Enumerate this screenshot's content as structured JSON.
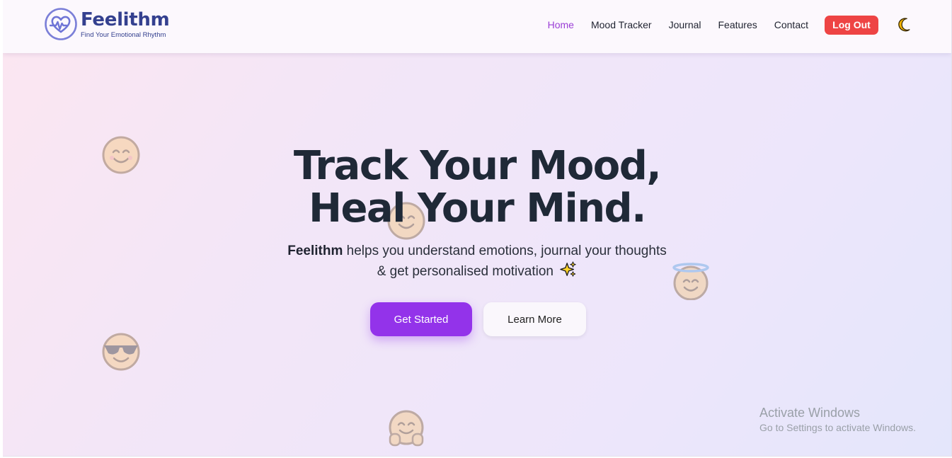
{
  "brand": {
    "name": "Feelithm",
    "tagline": "Find Your Emotional Rhythm",
    "logo_icon": "heart-pulse-icon",
    "color": "#34408f"
  },
  "nav": {
    "links": [
      "Home",
      "Mood Tracker",
      "Journal",
      "Features",
      "Contact"
    ],
    "active": "Home",
    "logout_label": "Log Out",
    "theme_icon": "moon-icon"
  },
  "hero": {
    "title_line1": "Track Your Mood,",
    "title_line2": "Heal Your Mind.",
    "subtitle_brand": "Feelithm",
    "subtitle_rest": " helps you understand emotions, journal your thoughts",
    "subtitle_line2": "& get personalised motivation",
    "subtitle_icon": "sparkles-icon",
    "primary_button": "Get Started",
    "secondary_button": "Learn More"
  },
  "floating_emojis": [
    "smiling-face-icon",
    "smiling-face-icon",
    "halo-face-icon",
    "sunglasses-face-icon",
    "hugging-face-icon"
  ],
  "watermark": {
    "title": "Activate Windows",
    "subtitle": "Go to Settings to activate Windows."
  },
  "colors": {
    "accent": "#9333ea",
    "active_link": "#9b3fd6",
    "logout": "#ee4444",
    "title": "#1f2937"
  }
}
